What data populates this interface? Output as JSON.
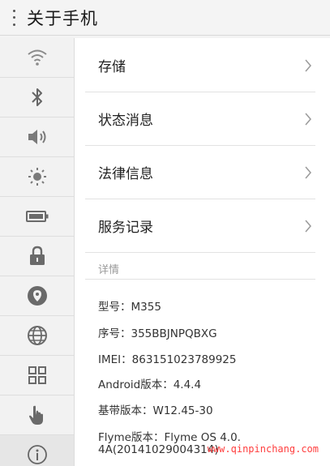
{
  "header": {
    "title": "关于手机"
  },
  "sidebar": {
    "items": [
      {
        "icon": "wifi-icon"
      },
      {
        "icon": "bluetooth-icon"
      },
      {
        "icon": "volume-icon"
      },
      {
        "icon": "brightness-icon"
      },
      {
        "icon": "battery-icon"
      },
      {
        "icon": "lock-icon"
      },
      {
        "icon": "location-icon"
      },
      {
        "icon": "globe-icon"
      },
      {
        "icon": "apps-grid-icon"
      },
      {
        "icon": "hand-gesture-icon"
      },
      {
        "icon": "info-icon",
        "active": true
      }
    ]
  },
  "menu": {
    "items": [
      {
        "label": "存储"
      },
      {
        "label": "状态消息"
      },
      {
        "label": "法律信息"
      },
      {
        "label": "服务记录"
      }
    ]
  },
  "details": {
    "section_title": "详情",
    "lines": [
      "型号：M355",
      "序号：355BBJNPQBXG",
      "IMEI：863151023789925",
      "Android版本：4.4.4",
      "基带版本：W12.45-30",
      "Flyme版本：Flyme OS 4.0.",
      "4A(20141029004314)"
    ]
  },
  "watermark": {
    "text": "www.qinpinchang.com"
  },
  "colors": {
    "watermark": "#ff3d3d",
    "divider": "#e2e2e2",
    "sidebar_bg": "#f2f2f2"
  }
}
